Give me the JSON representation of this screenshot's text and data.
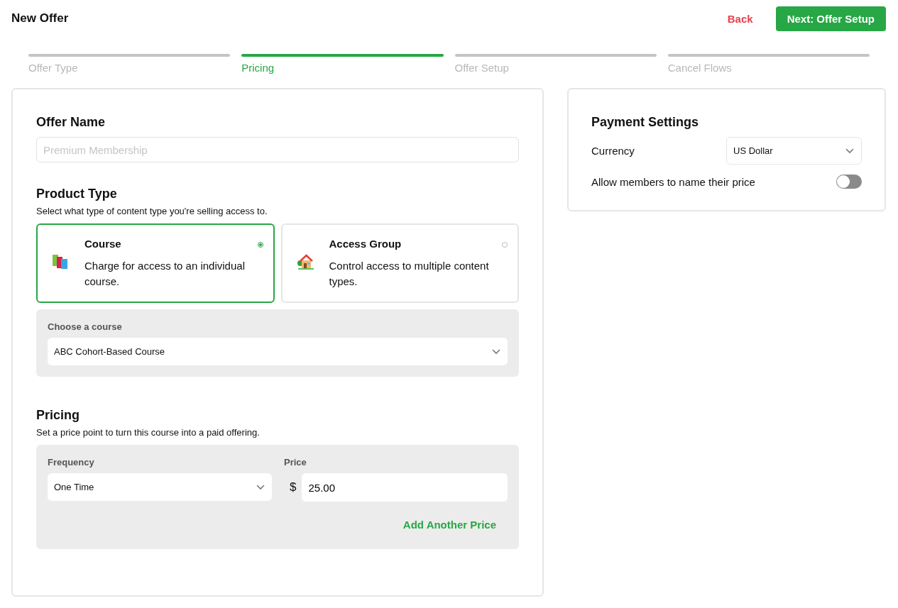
{
  "header": {
    "title": "New Offer",
    "back": "Back",
    "next": "Next: Offer Setup"
  },
  "steps": [
    {
      "label": "Offer Type",
      "selected": false
    },
    {
      "label": "Pricing",
      "selected": true
    },
    {
      "label": "Offer Setup",
      "selected": false
    },
    {
      "label": "Cancel Flows",
      "selected": false
    }
  ],
  "offer_name": {
    "heading": "Offer Name",
    "placeholder": "Premium Membership"
  },
  "product_type": {
    "heading": "Product Type",
    "description": "Select what type of content type you're selling access to.",
    "options": [
      {
        "kind": "course",
        "title": "Course",
        "description": "Charge for access to an individual course.",
        "selected": true
      },
      {
        "kind": "group",
        "title": "Access Group",
        "description": "Control access to multiple content types.",
        "selected": false
      }
    ],
    "course_label": "Choose a course",
    "course_value": "ABC Cohort-Based Course"
  },
  "pricing": {
    "heading": "Pricing",
    "description": "Set a price point to turn this course into a paid offering.",
    "frequency_label": "Frequency",
    "frequency_value": "One Time",
    "price_label": "Price",
    "currency_symbol": "$",
    "price_value": "25.00",
    "add_price": "Add Another Price"
  },
  "payment_settings": {
    "heading": "Payment Settings",
    "currency_label": "Currency",
    "currency_value": "US Dollar",
    "name_price_label": "Allow members to name their price",
    "name_price_on": false
  }
}
